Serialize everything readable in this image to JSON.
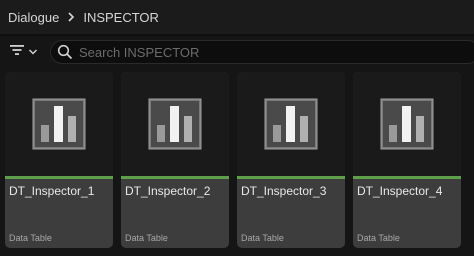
{
  "breadcrumb": {
    "items": [
      "Dialogue",
      "INSPECTOR"
    ]
  },
  "toolbar": {
    "filter_icon": "filter-lines-icon",
    "search_placeholder": "Search INSPECTOR",
    "search_value": ""
  },
  "assets": [
    {
      "name": "DT_Inspector_1",
      "type": "Data Table",
      "icon": "data-table-icon"
    },
    {
      "name": "DT_Inspector_2",
      "type": "Data Table",
      "icon": "data-table-icon"
    },
    {
      "name": "DT_Inspector_3",
      "type": "Data Table",
      "icon": "data-table-icon"
    },
    {
      "name": "DT_Inspector_4",
      "type": "Data Table",
      "icon": "data-table-icon"
    }
  ],
  "colors": {
    "asset_type_accent": "#5ea04a",
    "tile_background": "#3d3d3d",
    "thumbnail_background": "#1a1a1a",
    "search_background": "#0d0d0d"
  }
}
